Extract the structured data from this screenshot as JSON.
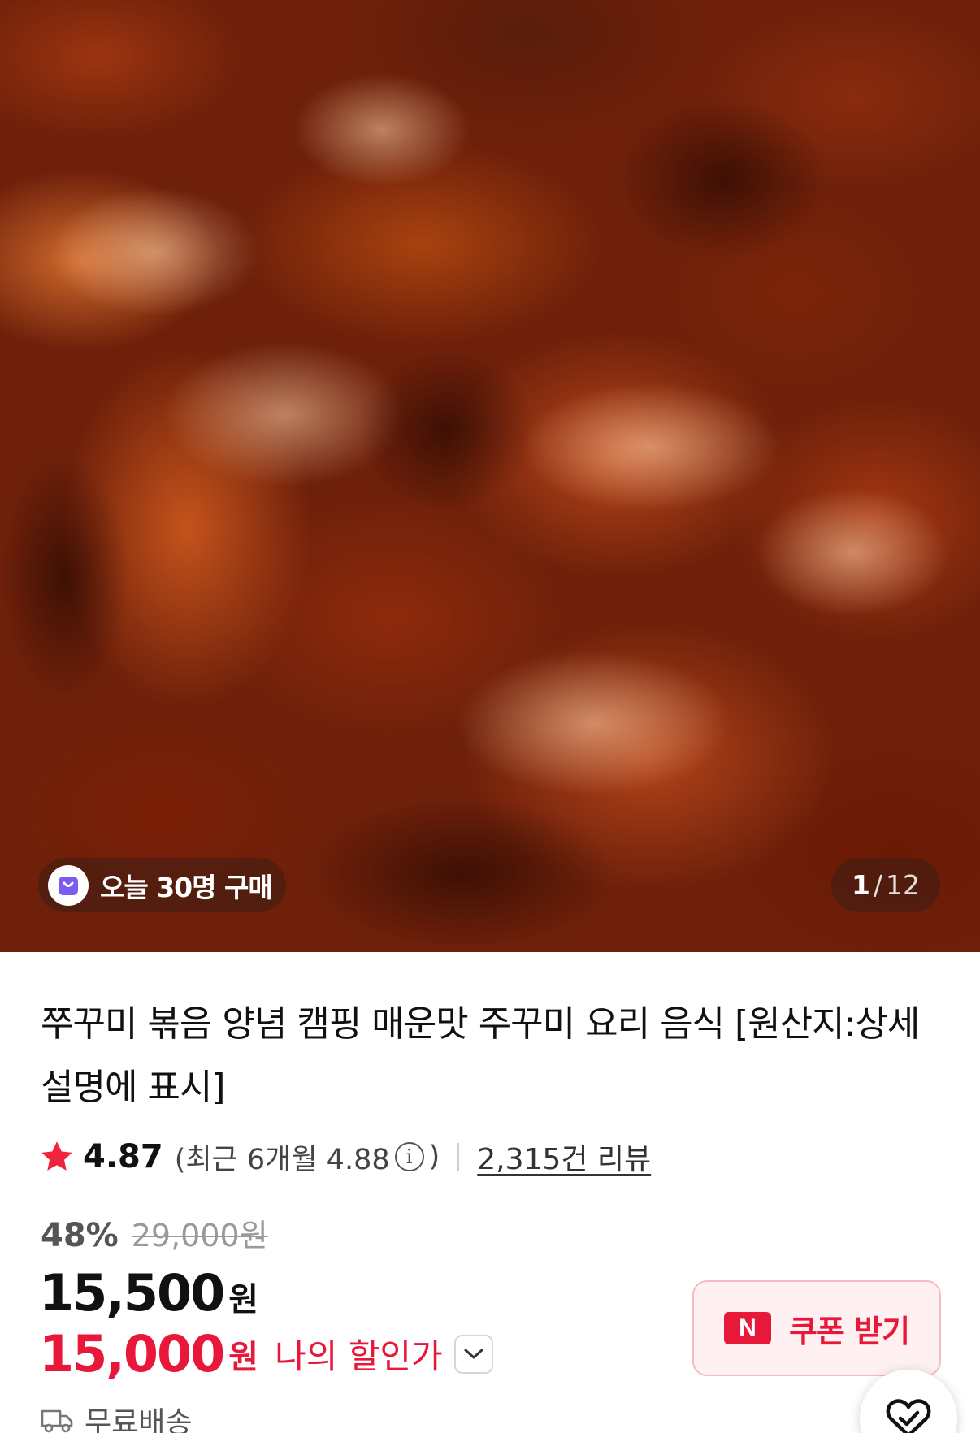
{
  "hero": {
    "badge_today": "오늘 30명 구매",
    "pager": {
      "current": "1",
      "separator": "/",
      "total": "12"
    }
  },
  "product": {
    "title": "쭈꾸미 볶음 양념 캠핑 매운맛 주꾸미 요리 음식 [원산지:상세설명에 표시]",
    "rating": {
      "score": "4.87",
      "recent_prefix": "(최근 6개월 4.88",
      "recent_suffix": ")",
      "info_icon_glyph": "i",
      "reviews": "2,315건 리뷰"
    },
    "pricing": {
      "discount_percent": "48%",
      "original_price": "29,000원",
      "price": "15,500",
      "price_unit": "원",
      "my_price": "15,000",
      "my_price_unit": "원",
      "my_price_label": "나의 할인가"
    },
    "coupon": {
      "npay_logo": "N",
      "label": "쿠폰 받기"
    },
    "shipping": {
      "label": "무료배송"
    }
  },
  "colors": {
    "accent_red": "#e8183b",
    "coupon_bg": "#fff1f2",
    "badge_icon": "#7b5cf0"
  },
  "icons": {
    "star": "star-icon",
    "info": "info-icon",
    "chevron": "chevron-down-icon",
    "shopping_bag": "shopping-bag-icon",
    "truck": "truck-icon",
    "fab": "heart-check-icon"
  }
}
